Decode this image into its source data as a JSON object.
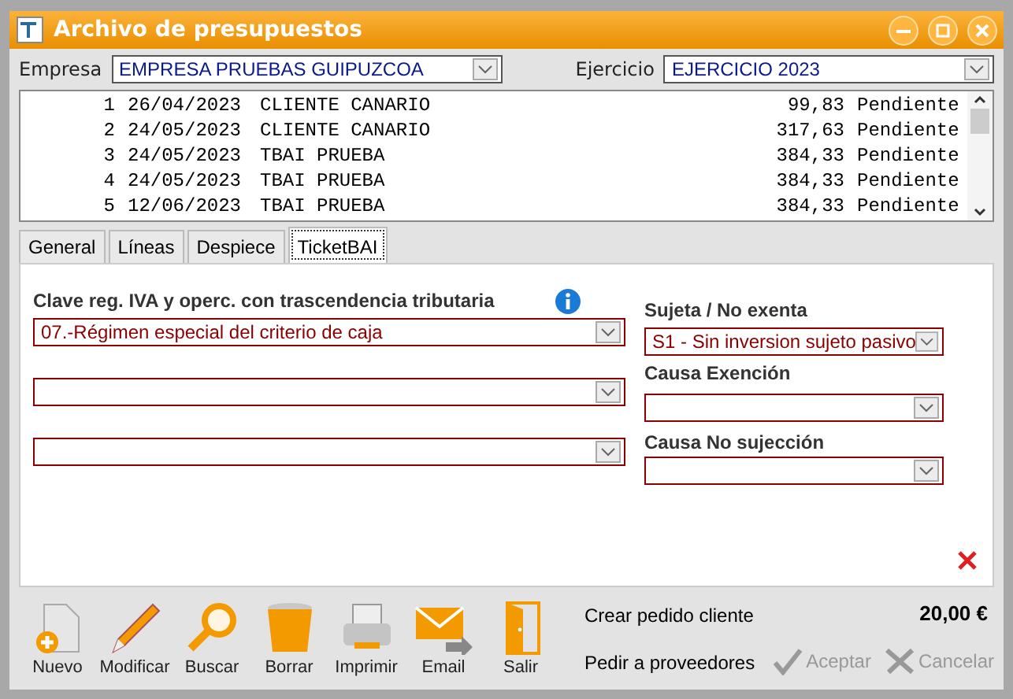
{
  "window": {
    "title": "Archivo de presupuestos"
  },
  "filters": [
    {
      "label": "Empresa",
      "value": "EMPRESA PRUEBAS GUIPUZCOA"
    },
    {
      "label": "Ejercicio",
      "value": "EJERCICIO 2023"
    }
  ],
  "list": {
    "rows": [
      {
        "number": "1",
        "date": "26/04/2023",
        "client": "CLIENTE CANARIO",
        "amount": "99,83",
        "status": "Pendiente"
      },
      {
        "number": "2",
        "date": "24/05/2023",
        "client": "CLIENTE CANARIO",
        "amount": "317,63",
        "status": "Pendiente"
      },
      {
        "number": "3",
        "date": "24/05/2023",
        "client": "TBAI PRUEBA",
        "amount": "384,33",
        "status": "Pendiente"
      },
      {
        "number": "4",
        "date": "24/05/2023",
        "client": "TBAI PRUEBA",
        "amount": "384,33",
        "status": "Pendiente"
      },
      {
        "number": "5",
        "date": "12/06/2023",
        "client": "TBAI PRUEBA",
        "amount": "384,33",
        "status": "Pendiente"
      }
    ]
  },
  "tabs": [
    {
      "label": "General",
      "selected": false
    },
    {
      "label": "Líneas",
      "selected": false
    },
    {
      "label": "Despiece",
      "selected": false
    },
    {
      "label": "TicketBAI",
      "selected": true
    }
  ],
  "ticketbai": {
    "left_label": "Clave reg. IVA y operc. con trascendencia tributaria",
    "left_fields": [
      {
        "kind": "dropdown",
        "value": "07.-Régimen especial del criterio de caja"
      },
      {
        "kind": "dropdown"
      },
      {
        "kind": "dropdown"
      }
    ],
    "right_fields": [
      {
        "label": "Sujeta / No exenta",
        "value": "S1 - Sin inversion sujeto pasivo"
      },
      {
        "label": "Causa Exención"
      },
      {
        "label": "Causa No sujección"
      }
    ]
  },
  "toolbar": [
    {
      "kind": "new",
      "label": "Nuevo"
    },
    {
      "kind": "edit",
      "label": "Modificar"
    },
    {
      "kind": "search",
      "label": "Buscar"
    },
    {
      "kind": "delete",
      "label": "Borrar"
    },
    {
      "kind": "print",
      "label": "Imprimir"
    },
    {
      "kind": "email",
      "label": "Email"
    },
    {
      "kind": "exit",
      "label": "Salir"
    }
  ],
  "links": [
    "Crear pedido cliente",
    "Pedir a proveedores"
  ],
  "total": "20,00 €",
  "actions": [
    {
      "kind": "accept",
      "label": "Aceptar",
      "disabled": true
    },
    {
      "kind": "cancel",
      "label": "Cancelar",
      "disabled": true
    }
  ]
}
